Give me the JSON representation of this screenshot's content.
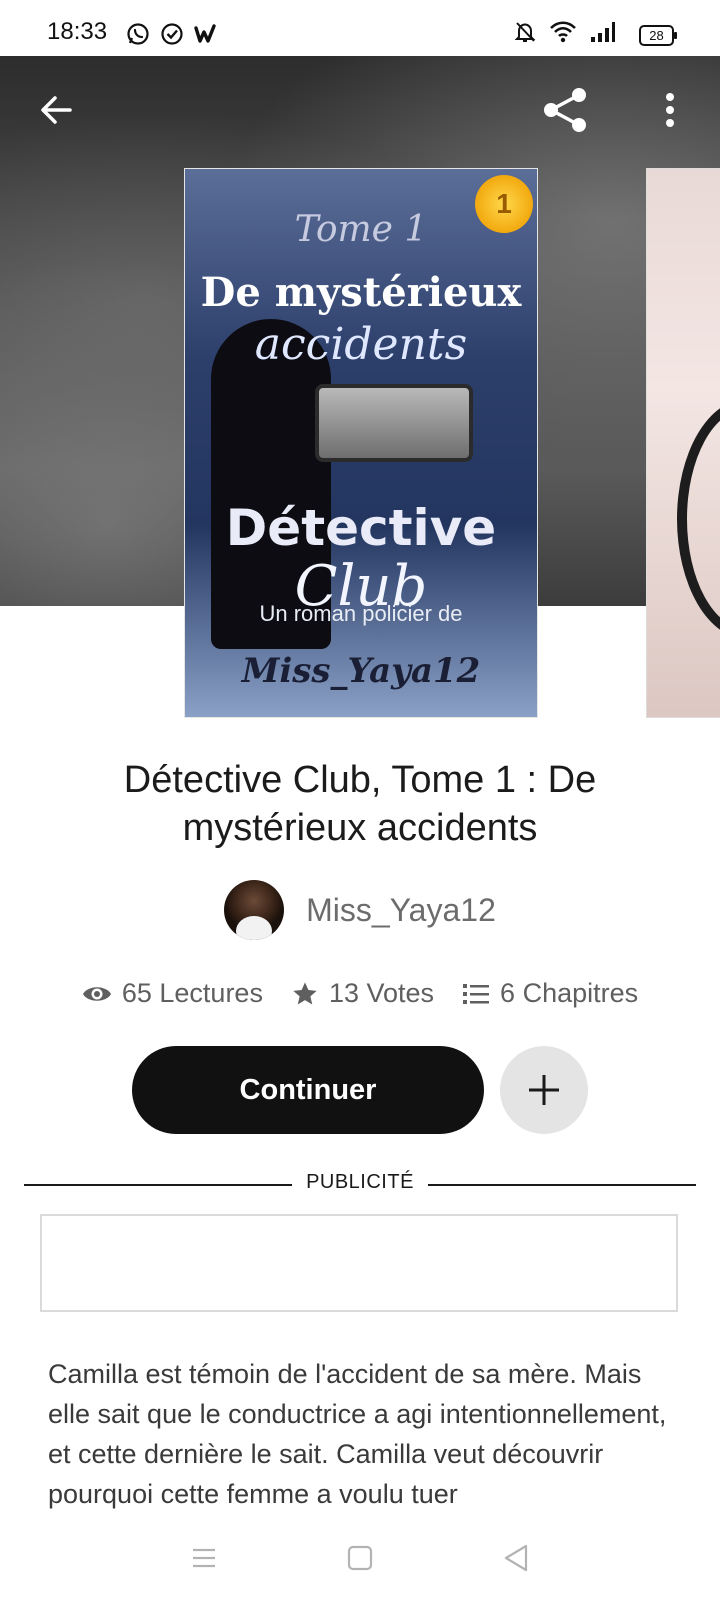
{
  "status_bar": {
    "time": "18:33",
    "battery": "28",
    "icons": [
      "whatsapp-icon",
      "check-circle-icon",
      "wattpad-icon",
      "bell-off-icon",
      "wifi-icon",
      "signal-icon",
      "battery-icon"
    ]
  },
  "top_bar": {
    "icons": [
      "back-arrow-icon",
      "share-icon",
      "more-vert-icon"
    ]
  },
  "book": {
    "cover": {
      "tome_text": "Tome 1",
      "de_text": "De mystérieux",
      "accidents_text": "accidents",
      "detective_text": "Détective",
      "club_text": "Club",
      "subtitle_text": "Un roman policier de",
      "author_text": "Miss_Yaya12",
      "badge_text": "1"
    },
    "title": "Détective Club, Tome 1 : De mystérieux accidents",
    "author": "Miss_Yaya12",
    "stats": {
      "reads": "65 Lectures",
      "votes": "13 Votes",
      "chapters": "6 Chapitres"
    },
    "continue_label": "Continuer",
    "description": "Camilla est témoin de l'accident de sa mère. Mais elle sait que le conductrice a agi intentionnellement, et cette dernière le sait. Camilla veut découvrir pourquoi cette femme a voulu tuer"
  },
  "ad": {
    "label": "PUBLICITÉ"
  },
  "colors": {
    "primary_button": "#111111",
    "secondary_button": "#e4e4e4",
    "text_muted": "#5f5f5f"
  }
}
